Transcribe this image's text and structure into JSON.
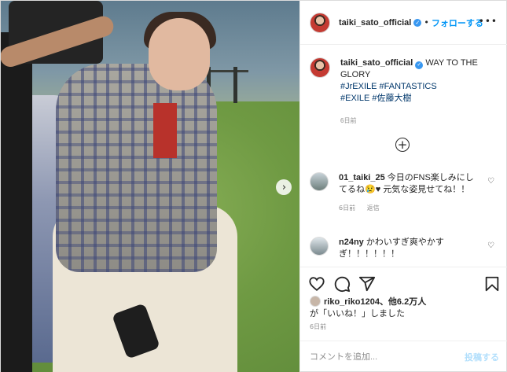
{
  "post": {
    "username": "taiki_sato_official",
    "follow_label": "フォローする",
    "more_label": "•••",
    "caption_text": "WAY TO THE GLORY",
    "hashtags": [
      "#JrEXILE",
      "#FANTASTICS",
      "#EXILE",
      "#佐藤大樹"
    ],
    "caption_time": "6日前"
  },
  "comments": [
    {
      "username": "01_taiki_25",
      "text": "今日のFNS楽しみにしてるね😢♥ 元気な姿見せてね！！",
      "time": "6日前",
      "reply_label": "返信"
    },
    {
      "username": "n24ny",
      "text": "かわいすぎ爽やかすぎ！！！！！！"
    }
  ],
  "likes": {
    "username": "riko_riko1204",
    "suffix": "、他6.2万人",
    "line2": "が「いいね！」しました"
  },
  "post_time": "6日前",
  "add_comment": {
    "placeholder": "コメントを追加...",
    "post_label": "投稿する"
  },
  "icons": {
    "verified": "verified-badge-icon",
    "add": "plus-circle-icon",
    "next": "chevron-right-icon",
    "like": "heart-icon",
    "comment": "comment-bubble-icon",
    "share": "paper-plane-icon",
    "save": "bookmark-icon"
  },
  "colors": {
    "accent": "#0095f6",
    "hashtag": "#00376b",
    "muted": "#8e8e8e"
  }
}
